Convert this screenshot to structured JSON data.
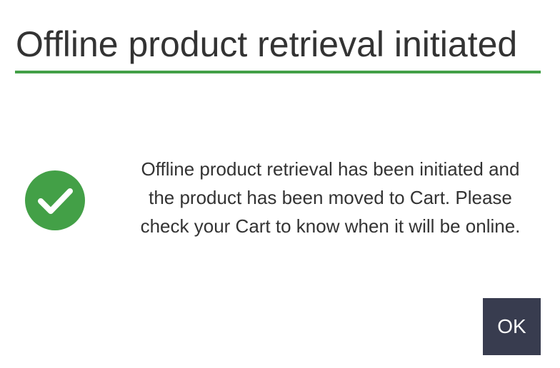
{
  "dialog": {
    "title": "Offline product retrieval initiated",
    "message": "Offline product retrieval has been initiated and the product has been moved to Cart. Please check your Cart to know when it will be online.",
    "ok_label": "OK",
    "icon": "success-check-icon"
  },
  "colors": {
    "accent_green": "#43a047",
    "button_bg": "#383c4f",
    "text": "#333333"
  }
}
